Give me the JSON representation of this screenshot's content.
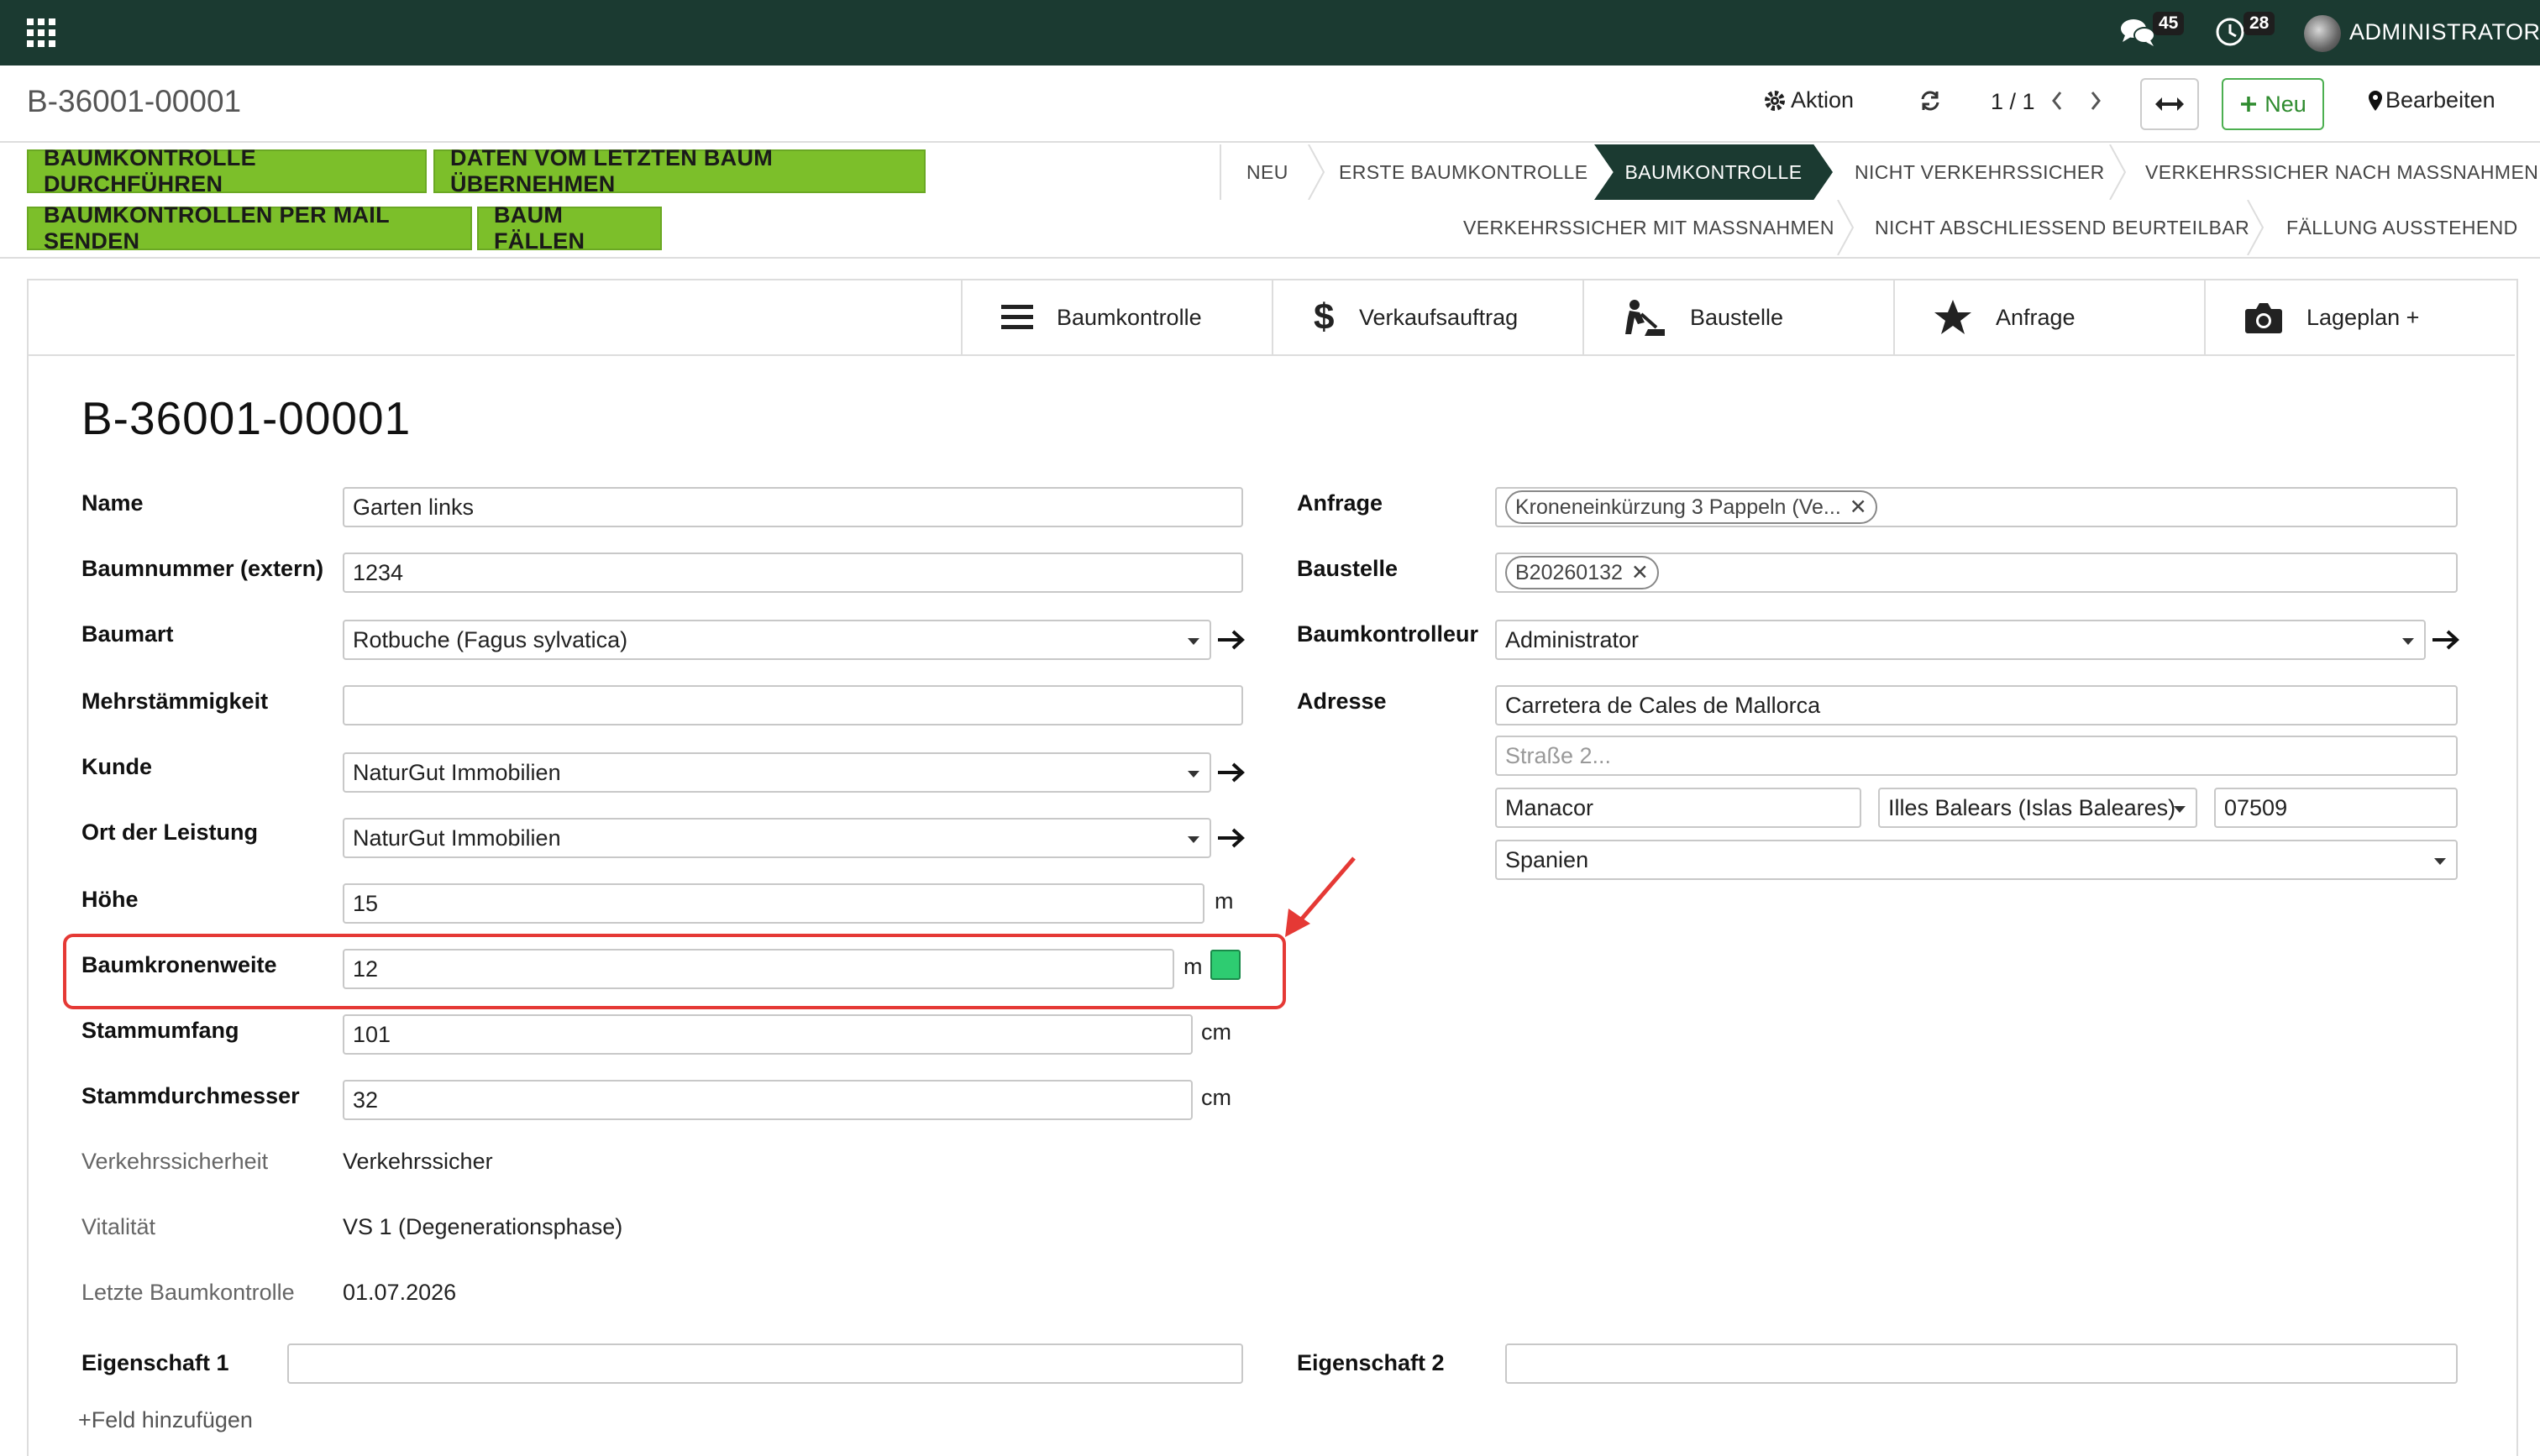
{
  "navbar": {
    "messages_count": "45",
    "activities_count": "28",
    "user": "ADMINISTRATOR"
  },
  "control_panel": {
    "breadcrumb": "B-36001-00001",
    "action": "Aktion",
    "pager": "1 / 1",
    "new": "Neu",
    "edit": "Bearbeiten"
  },
  "actions": {
    "run_control": "BAUMKONTROLLE DURCHFÜHREN",
    "copy_last": "DATEN VOM LETZTEN BAUM ÜBERNEHMEN",
    "send_mail": "BAUMKONTROLLEN PER MAIL SENDEN",
    "fell_tree": "BAUM FÄLLEN"
  },
  "stages": {
    "row1": [
      "NEU",
      "ERSTE BAUMKONTROLLE",
      "BAUMKONTROLLE",
      "NICHT VERKEHRSSICHER",
      "VERKEHRSSICHER NACH MASSNAHMEN"
    ],
    "row2": [
      "VERKEHRSSICHER MIT MASSNAHMEN",
      "NICHT ABSCHLIESSEND BEURTEILBAR",
      "FÄLLUNG AUSSTEHEND"
    ],
    "active": "BAUMKONTROLLE"
  },
  "smart_buttons": {
    "baumkontrolle": "Baumkontrolle",
    "verkaufsauftrag": "Verkaufsauftrag",
    "baustelle": "Baustelle",
    "anfrage": "Anfrage",
    "lageplan": "Lageplan +"
  },
  "record": {
    "title": "B-36001-00001"
  },
  "left_fields": {
    "name": {
      "label": "Name",
      "value": "Garten links"
    },
    "baumnummer": {
      "label": "Baumnummer (extern)",
      "value": "1234"
    },
    "baumart": {
      "label": "Baumart",
      "value": "Rotbuche (Fagus sylvatica)"
    },
    "mehrstaemmigkeit": {
      "label": "Mehrstämmigkeit",
      "value": ""
    },
    "kunde": {
      "label": "Kunde",
      "value": "NaturGut Immobilien"
    },
    "ort": {
      "label": "Ort der Leistung",
      "value": "NaturGut Immobilien"
    },
    "hoehe": {
      "label": "Höhe",
      "value": "15",
      "unit": "m"
    },
    "kronenweite": {
      "label": "Baumkronenweite",
      "value": "12",
      "unit": "m"
    },
    "stammumfang": {
      "label": "Stammumfang",
      "value": "101",
      "unit": "cm"
    },
    "stammdurchmesser": {
      "label": "Stammdurchmesser",
      "value": "32",
      "unit": "cm"
    },
    "verkehrssicherheit": {
      "label": "Verkehrssicherheit",
      "value": "Verkehrssicher"
    },
    "vitalitaet": {
      "label": "Vitalität",
      "value": "VS 1 (Degenerationsphase)"
    },
    "letzte": {
      "label": "Letzte Baumkontrolle",
      "value": "01.07.2026"
    }
  },
  "right_fields": {
    "anfrage": {
      "label": "Anfrage",
      "tag": "Kroneneinkürzung 3 Pappeln (Ve..."
    },
    "baustelle": {
      "label": "Baustelle",
      "tag": "B20260132"
    },
    "kontrolleur": {
      "label": "Baumkontrolleur",
      "value": "Administrator"
    },
    "adresse": {
      "label": "Adresse",
      "street": "Carretera de Cales de Mallorca",
      "street2_placeholder": "Straße 2...",
      "city": "Manacor",
      "state": "Illes Balears (Islas Baleares)",
      "zip": "07509",
      "country": "Spanien"
    }
  },
  "properties": {
    "prop1": "Eigenschaft 1",
    "prop2": "Eigenschaft 2",
    "add_field": "+Feld hinzufügen"
  },
  "colors": {
    "navbar": "#1b3a31",
    "action_green": "#7cbf2a",
    "highlight_red": "#e53935",
    "toggle_green": "#2ecc71"
  }
}
